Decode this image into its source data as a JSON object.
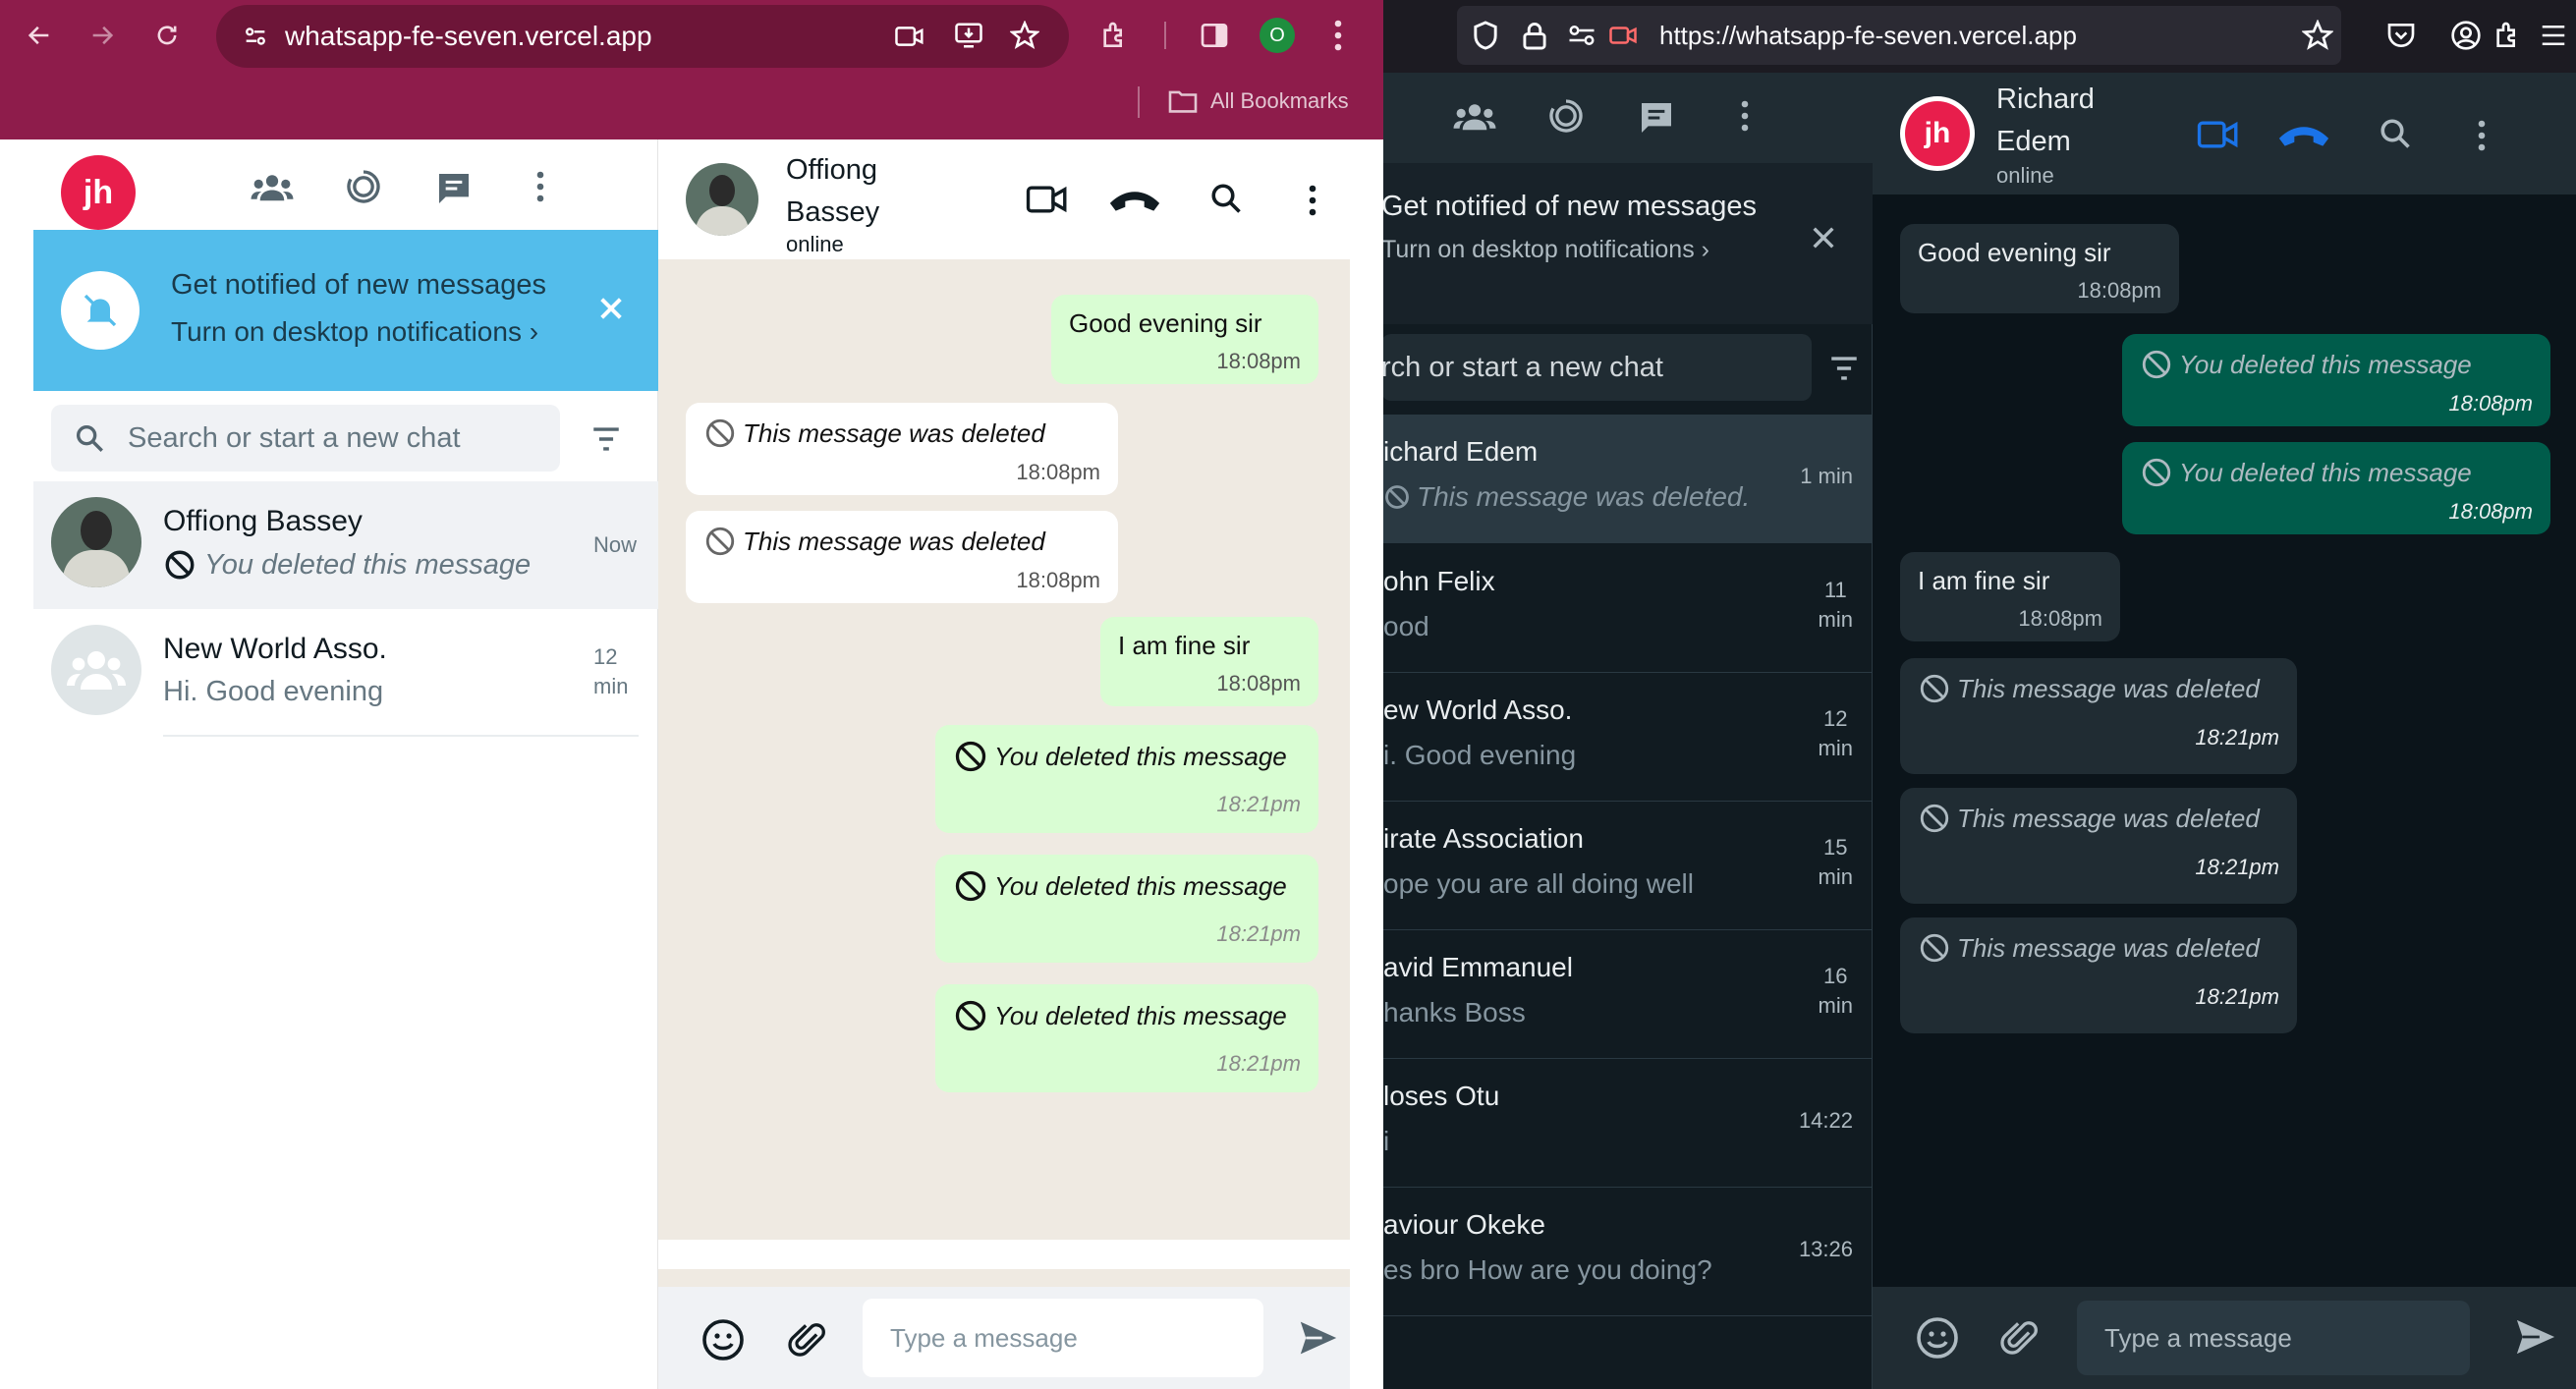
{
  "left_browser": {
    "url": "whatsapp-fe-seven.vercel.app",
    "profile_initial": "O",
    "bookmarks_label": "All Bookmarks",
    "colors": {
      "toolbar": "#8e1c4b",
      "url_bar": "#6d1538"
    }
  },
  "left_app": {
    "logo_text": "jh",
    "banner": {
      "title": "Get notified of new messages",
      "link": "Turn on desktop notifications ›"
    },
    "search_placeholder": "Search or start a new chat",
    "chats": [
      {
        "name": "Offiong Bassey",
        "preview": "You deleted this message",
        "time": "Now"
      },
      {
        "name": "New World Asso.",
        "preview": "Hi. Good evening",
        "time_line1": "12",
        "time_line2": "min"
      }
    ],
    "chat_header": {
      "name_line1": "Offiong",
      "name_line2": "Bassey",
      "status": "online"
    },
    "messages": [
      {
        "text": "Good evening sir",
        "time": "18:08pm"
      },
      {
        "text": "This message was deleted",
        "time": "18:08pm"
      },
      {
        "text": "This message was deleted",
        "time": "18:08pm"
      },
      {
        "text": "I am fine sir",
        "time": "18:08pm"
      },
      {
        "text": "You deleted this message",
        "time": "18:21pm"
      },
      {
        "text": "You deleted this message",
        "time": "18:21pm"
      },
      {
        "text": "You deleted this message",
        "time": "18:21pm"
      }
    ],
    "composer_placeholder": "Type a message"
  },
  "right_browser": {
    "url": "https://whatsapp-fe-seven.vercel.app"
  },
  "right_app": {
    "banner": {
      "title": "Get notified of new messages",
      "link": "Turn on desktop notifications ›"
    },
    "search_placeholder": "rch or start a new chat",
    "chats": [
      {
        "name": "ichard Edem",
        "preview": "This message was deleted.",
        "t1": "1 min",
        "t2": ""
      },
      {
        "name": "ohn Felix",
        "preview": "ood",
        "t1": "11",
        "t2": "min"
      },
      {
        "name": "ew World Asso.",
        "preview": "i. Good evening",
        "t1": "12",
        "t2": "min"
      },
      {
        "name": "irate Association",
        "preview": "ope you are all doing well",
        "t1": "15",
        "t2": "min"
      },
      {
        "name": "avid Emmanuel",
        "preview": "hanks Boss",
        "t1": "16",
        "t2": "min"
      },
      {
        "name": "loses Otu",
        "preview": "i",
        "t1": "14:22",
        "t2": ""
      },
      {
        "name": "aviour Okeke",
        "preview": "es bro How are you doing?",
        "t1": "13:26",
        "t2": ""
      }
    ],
    "chat_header": {
      "logo_text": "jh",
      "name_line1": "Richard",
      "name_line2": "Edem",
      "status": "online"
    },
    "messages": [
      {
        "text": "Good evening sir",
        "time": "18:08pm"
      },
      {
        "text": "You deleted this message",
        "time": "18:08pm"
      },
      {
        "text": "You deleted this message",
        "time": "18:08pm"
      },
      {
        "text": "I am fine sir",
        "time": "18:08pm"
      },
      {
        "text": "This message was deleted",
        "time": "18:21pm"
      },
      {
        "text": "This message was deleted",
        "time": "18:21pm"
      },
      {
        "text": "This message was deleted",
        "time": "18:21pm"
      }
    ],
    "composer_placeholder": "Type a message"
  }
}
